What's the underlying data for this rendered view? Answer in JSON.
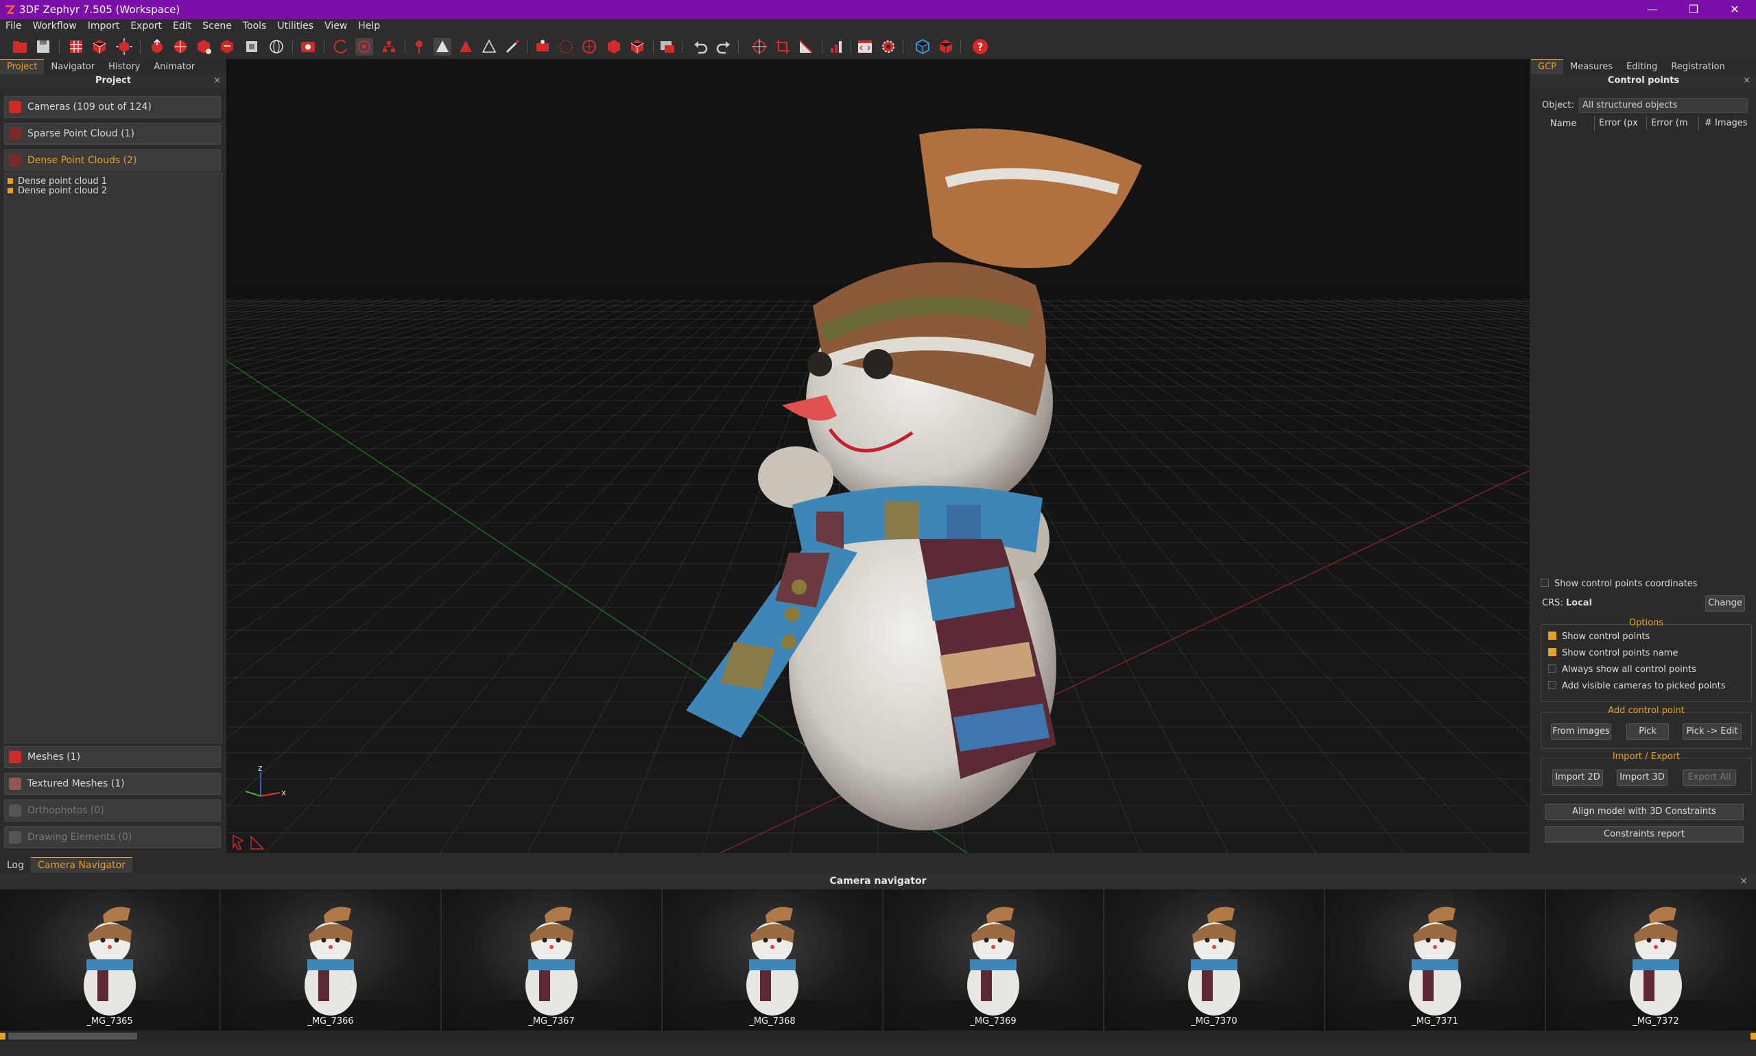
{
  "window": {
    "title": "3DF Zephyr 7.505 (Workspace)"
  },
  "menu": [
    "File",
    "Workflow",
    "Import",
    "Export",
    "Edit",
    "Scene",
    "Tools",
    "Utilities",
    "View",
    "Help"
  ],
  "left_panel": {
    "tabs": [
      "Project",
      "Navigator",
      "History",
      "Animator"
    ],
    "header": "Project",
    "close": "×",
    "sections": {
      "cameras": "Cameras (109 out of 124)",
      "sparse": "Sparse Point Cloud (1)",
      "dense": "Dense Point Clouds (2)",
      "meshes": "Meshes (1)",
      "textured": "Textured Meshes (1)",
      "ortho": "Orthophotos (0)",
      "drawing": "Drawing Elements (0)"
    },
    "dense_items": [
      "Dense point cloud 1",
      "Dense point cloud 2"
    ]
  },
  "right_panel": {
    "tabs": [
      "GCP",
      "Measures",
      "Editing",
      "Registration"
    ],
    "header": "Control points",
    "close": "×",
    "object_label": "Object:",
    "object_value": "All structured objects",
    "columns": [
      "Name",
      "Error (px",
      "Error (m",
      "# Images"
    ],
    "show_coords": "Show control points coordinates",
    "crs_label": "CRS:",
    "crs_value": "Local",
    "change": "Change",
    "options_title": "Options",
    "options": [
      {
        "label": "Show control points",
        "checked": true
      },
      {
        "label": "Show control points name",
        "checked": true
      },
      {
        "label": "Always show all control points",
        "checked": false
      },
      {
        "label": "Add visible cameras to picked points",
        "checked": false
      }
    ],
    "add_title": "Add control point",
    "add_buttons": [
      "From images",
      "Pick",
      "Pick -> Edit"
    ],
    "ie_title": "Import / Export",
    "ie_buttons": [
      "Import 2D",
      "Import 3D",
      "Export All"
    ],
    "align": "Align model with 3D Constraints",
    "report": "Constraints report"
  },
  "bottom": {
    "tabs": [
      "Log",
      "Camera Navigator"
    ],
    "header": "Camera navigator",
    "close": "×",
    "thumbs": [
      "_MG_7365",
      "_MG_7366",
      "_MG_7367",
      "_MG_7368",
      "_MG_7369",
      "_MG_7370",
      "_MG_7371",
      "_MG_7372"
    ]
  },
  "axis": {
    "z": "z",
    "x": "x"
  },
  "colors": {
    "titlebar": "#7b10a8",
    "accent": "#e8a028",
    "toolbar_red": "#e03030"
  }
}
